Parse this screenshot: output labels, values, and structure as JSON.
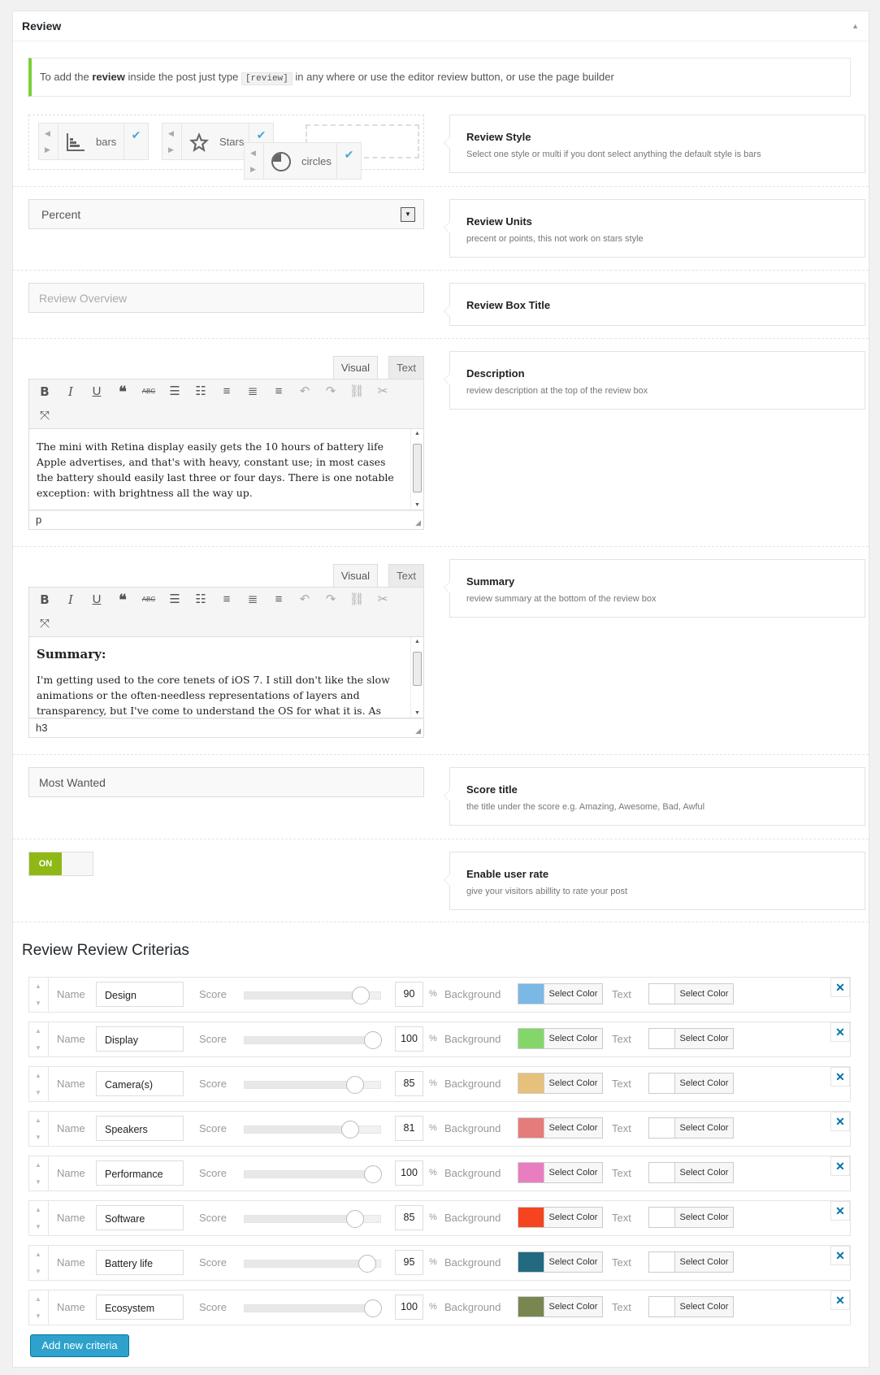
{
  "panel": {
    "title": "Review",
    "collapse_icon": "triangle-up-icon"
  },
  "notice": {
    "prefix": "To add the",
    "bold": "review",
    "middle": "inside the post just type",
    "code": "[review]",
    "suffix": "in any where or use the editor review button, or use the page builder"
  },
  "review_style": {
    "title": "Review Style",
    "subtitle": "Select one style or multi if you dont select anything the default style is bars",
    "options": [
      {
        "label": "bars",
        "icon": "bars-chart-icon",
        "checked": true
      },
      {
        "label": "Stars",
        "icon": "star-icon",
        "checked": true
      },
      {
        "label": "circles",
        "icon": "pie-circle-icon",
        "checked": true
      }
    ]
  },
  "review_units": {
    "title": "Review Units",
    "subtitle": "precent or points, this not work on stars style",
    "selected": "Percent"
  },
  "box_title": {
    "title": "Review Box Title",
    "placeholder": "Review Overview"
  },
  "description": {
    "title": "Description",
    "subtitle": "review description at the top of the review box",
    "tab_visual": "Visual",
    "tab_text": "Text",
    "content": "The mini with Retina display easily gets the 10 hours of battery life Apple advertises, and that's with heavy, constant use; in most cases the battery should easily last three or four days. There is one notable exception: with brightness all the way up.",
    "status": "p"
  },
  "summary": {
    "title": "Summary",
    "subtitle": "review summary at the bottom of the review box",
    "tab_visual": "Visual",
    "tab_text": "Text",
    "heading": "Summary:",
    "content": "I'm getting used to the core tenets of iOS 7. I still don't like the slow animations or the often-needless representations of layers and transparency, but I've come to understand the OS for what it is. As we discovered with the",
    "status": "h3"
  },
  "score_title": {
    "title": "Score title",
    "subtitle": "the title under the score e.g. Amazing, Awesome, Bad, Awful",
    "value": "Most Wanted"
  },
  "user_rate": {
    "title": "Enable user rate",
    "subtitle": "give your visitors abillity to rate your post",
    "toggle_label": "ON",
    "enabled": true
  },
  "criterias": {
    "heading": "Review Review Criterias",
    "name_label": "Name",
    "score_label": "Score",
    "pct_label": "%",
    "bg_label": "Background",
    "text_label": "Text",
    "select_color": "Select Color",
    "delete_icon": "close-x-icon",
    "add_button": "Add new criteria",
    "items": [
      {
        "name": "Design",
        "score": "90",
        "bg": "#7ab8e6",
        "text_color": "#ffffff"
      },
      {
        "name": "Display",
        "score": "100",
        "bg": "#84d66b",
        "text_color": "#ffffff"
      },
      {
        "name": "Camera(s)",
        "score": "85",
        "bg": "#e6c17c",
        "text_color": "#ffffff"
      },
      {
        "name": "Speakers",
        "score": "81",
        "bg": "#e57b7b",
        "text_color": "#ffffff"
      },
      {
        "name": "Performance",
        "score": "100",
        "bg": "#e87ec0",
        "text_color": "#ffffff"
      },
      {
        "name": "Software",
        "score": "85",
        "bg": "#f5441f",
        "text_color": "#ffffff"
      },
      {
        "name": "Battery life",
        "score": "95",
        "bg": "#216a82",
        "text_color": "#ffffff"
      },
      {
        "name": "Ecosystem",
        "score": "100",
        "bg": "#788650",
        "text_color": "#ffffff"
      }
    ]
  }
}
